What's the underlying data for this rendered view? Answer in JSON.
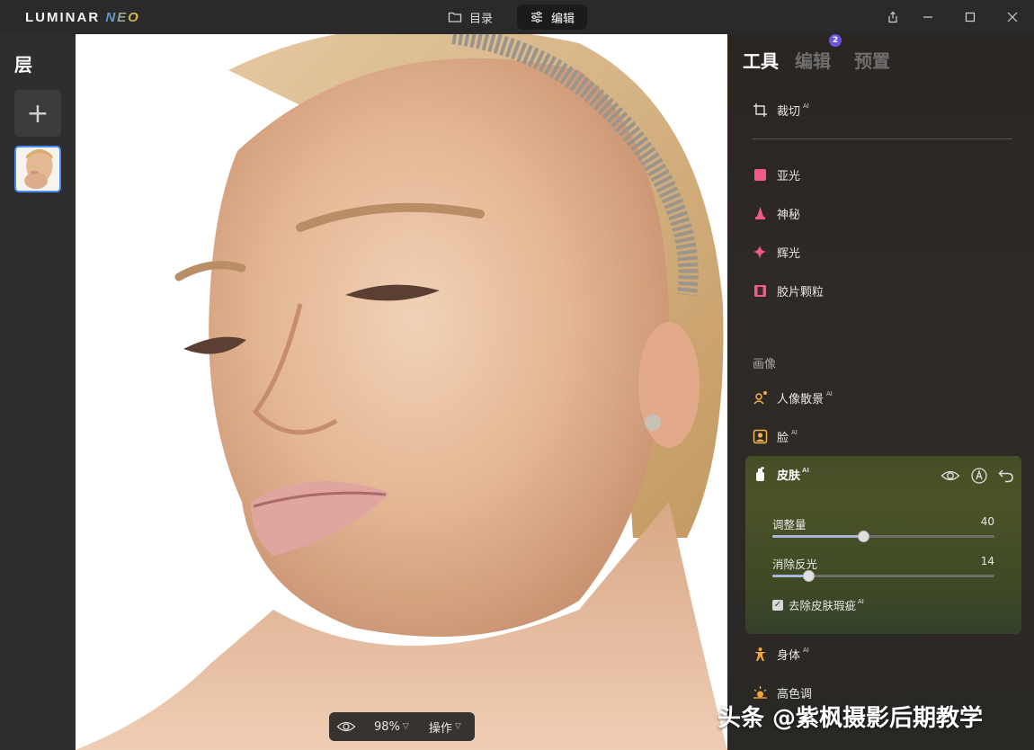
{
  "app": {
    "brand_main": "LUMINAR ",
    "brand_accent": "NEO"
  },
  "nav": {
    "catalog_label": "目录",
    "edit_label": "编辑"
  },
  "layers": {
    "title": "层",
    "add_symbol": "+"
  },
  "canvas": {
    "zoom_value": "98%",
    "actions_label": "操作"
  },
  "right_panel": {
    "tabs": [
      {
        "label": "工具",
        "active": true
      },
      {
        "label": "编辑",
        "badge": "2"
      },
      {
        "label": "预置"
      }
    ],
    "tools_top": [
      {
        "label": "裁切",
        "ai": "AI",
        "icon": "crop-icon"
      }
    ],
    "creative_tools": [
      {
        "label": "亚光",
        "icon": "matte-icon",
        "color": "#f25a8a"
      },
      {
        "label": "神秘",
        "icon": "mystical-icon",
        "color": "#f25a8a"
      },
      {
        "label": "辉光",
        "icon": "glow-icon",
        "color": "#f25a8a"
      },
      {
        "label": "胶片颗粒",
        "icon": "film-grain-icon",
        "color": "#f25a8a"
      }
    ],
    "portrait_section_label": "画像",
    "portrait_tools": [
      {
        "label": "人像散景",
        "ai": "AI",
        "icon": "portrait-bokeh-icon",
        "color": "#f2b34a"
      },
      {
        "label": "脸",
        "ai": "AI",
        "icon": "face-icon",
        "color": "#f2b34a"
      }
    ],
    "skin": {
      "label": "皮肤",
      "ai": "AI",
      "sliders": [
        {
          "label": "调整量",
          "value": "40",
          "level": 0.41
        },
        {
          "label": "消除反光",
          "value": "14",
          "level": 0.16
        }
      ],
      "checkbox_label": "去除皮肤瑕疵",
      "checkbox_ai": "AI",
      "checkbox_checked": true
    },
    "bottom_tools": [
      {
        "label": "身体",
        "ai": "AI",
        "icon": "body-icon",
        "color": "#f2a53a"
      },
      {
        "label": "高色调",
        "icon": "high-key-icon",
        "color": "#f2a53a"
      }
    ]
  },
  "watermark": "头条 @紫枫摄影后期教学"
}
